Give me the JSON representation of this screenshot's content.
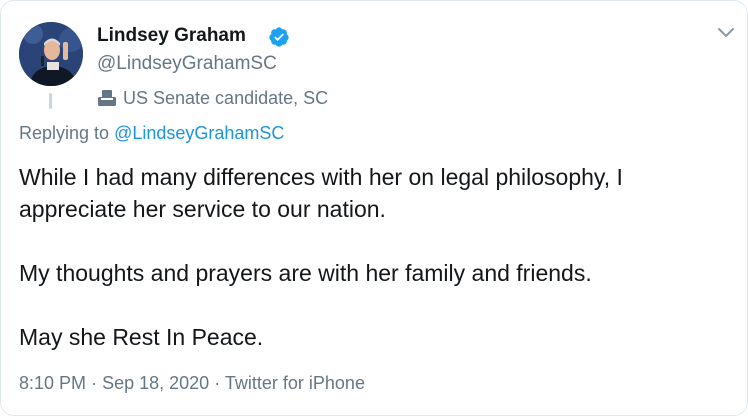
{
  "tweet": {
    "author": {
      "name": "Lindsey Graham",
      "handle": "@LindseyGrahamSC",
      "label": "US Senate candidate, SC",
      "label_icon": "ballot-box-icon",
      "verified_icon": "verified-badge-icon"
    },
    "replying": {
      "prefix": "Replying to",
      "mention": "@LindseyGrahamSC"
    },
    "paragraphs": [
      "While I had many differences with her on legal philosophy, I appreciate her service to our nation.",
      "My thoughts and prayers are with her family and friends.",
      "May she Rest In Peace."
    ],
    "meta": {
      "time": "8:10 PM",
      "date": "Sep 18, 2020",
      "source": "Twitter for iPhone",
      "separator": "·"
    },
    "colors": {
      "accent": "#1b95e0",
      "secondary_text": "#657786",
      "primary_text": "#14171a"
    }
  }
}
